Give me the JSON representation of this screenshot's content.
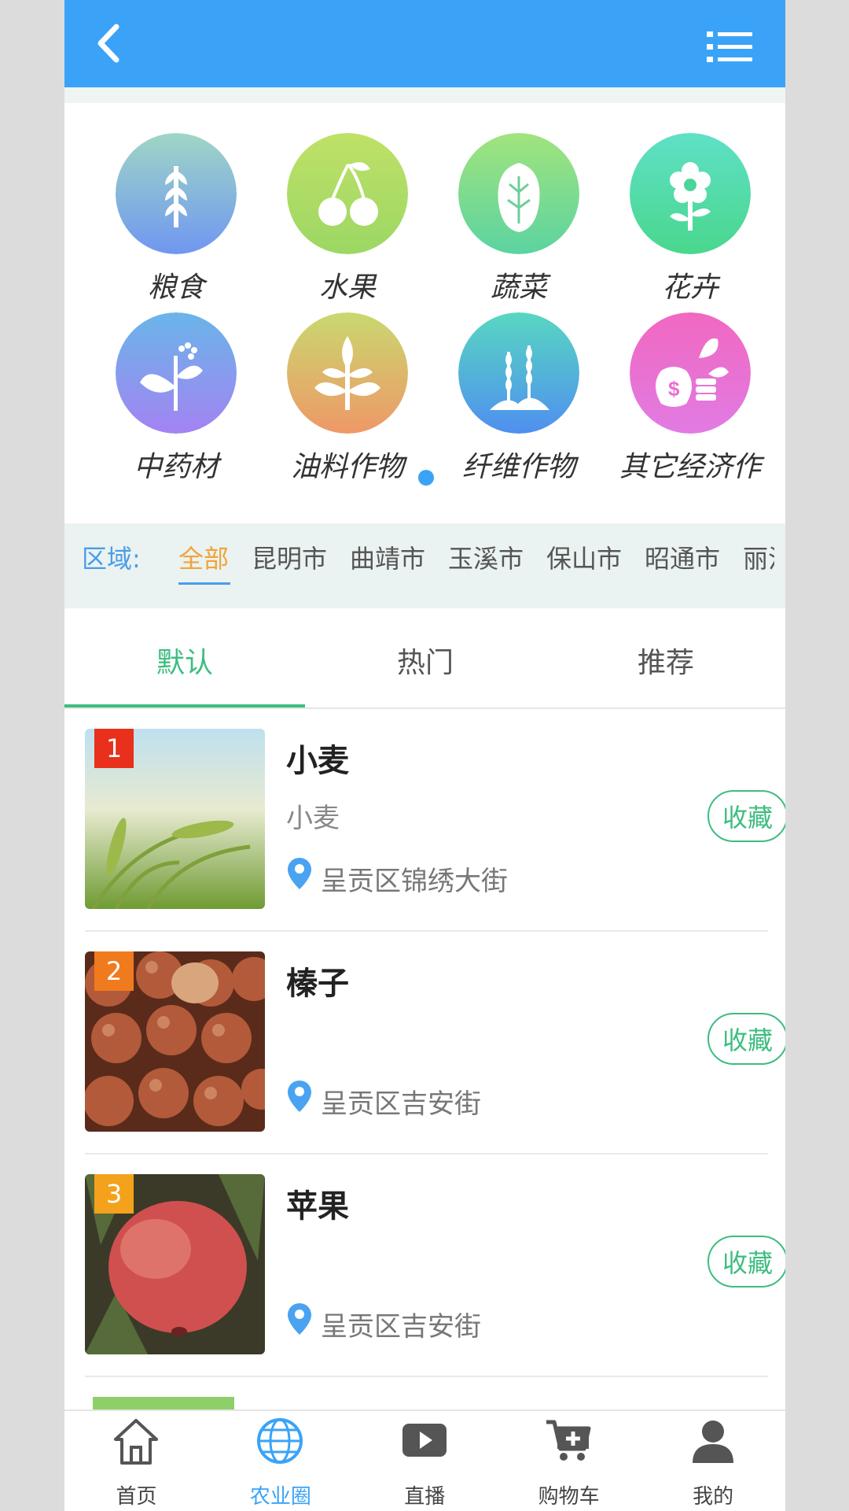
{
  "header": {
    "back_icon": "chevron-left-icon",
    "menu_icon": "list-menu-icon",
    "colors": {
      "bar": "#3aa3f7"
    }
  },
  "categories": [
    {
      "label": "粮食",
      "icon": "wheat-icon",
      "color_top": "#9fd6c5",
      "color_bottom": "#6f97f1"
    },
    {
      "label": "水果",
      "icon": "cherries-icon",
      "color_top": "#bfe167",
      "color_bottom": "#9cd764"
    },
    {
      "label": "蔬菜",
      "icon": "cabbage-icon",
      "color_top": "#a1e47d",
      "color_bottom": "#5bd3a1"
    },
    {
      "label": "花卉",
      "icon": "flower-icon",
      "color_top": "#5fe0c6",
      "color_bottom": "#49d78d"
    },
    {
      "label": "中药材",
      "icon": "herb-icon",
      "color_top": "#6ab5e9",
      "color_bottom": "#a383f2"
    },
    {
      "label": "油料作物",
      "icon": "sprout-icon",
      "color_top": "#c9d86f",
      "color_bottom": "#ef9867"
    },
    {
      "label": "纤维作物",
      "icon": "fiber-crop-icon",
      "color_top": "#58d7c1",
      "color_bottom": "#4f8ff0"
    },
    {
      "label": "其它经济作",
      "icon": "money-plant-icon",
      "color_top": "#f168c0",
      "color_bottom": "#e17be3"
    }
  ],
  "region": {
    "label": "区域:",
    "items": [
      "全部",
      "昆明市",
      "曲靖市",
      "玉溪市",
      "保山市",
      "昭通市",
      "丽江"
    ]
  },
  "tabs": [
    "默认",
    "热门",
    "推荐"
  ],
  "list": [
    {
      "rank": "1",
      "title": "小麦",
      "subtitle": "小麦",
      "location": "呈贡区锦绣大街",
      "fav": "收藏",
      "rank_color": "#e8301c",
      "image": "wheat-photo"
    },
    {
      "rank": "2",
      "title": "榛子",
      "subtitle": "",
      "location": "呈贡区吉安街",
      "fav": "收藏",
      "rank_color": "#f07a1e",
      "image": "hazelnut-photo"
    },
    {
      "rank": "3",
      "title": "苹果",
      "subtitle": "",
      "location": "呈贡区吉安街",
      "fav": "收藏",
      "rank_color": "#f4a21b",
      "image": "apple-photo"
    }
  ],
  "bottom_nav": [
    {
      "label": "首页",
      "icon": "home-icon"
    },
    {
      "label": "农业圈",
      "icon": "globe-icon",
      "active": true
    },
    {
      "label": "直播",
      "icon": "play-icon"
    },
    {
      "label": "购物车",
      "icon": "cart-icon"
    },
    {
      "label": "我的",
      "icon": "user-icon"
    }
  ]
}
